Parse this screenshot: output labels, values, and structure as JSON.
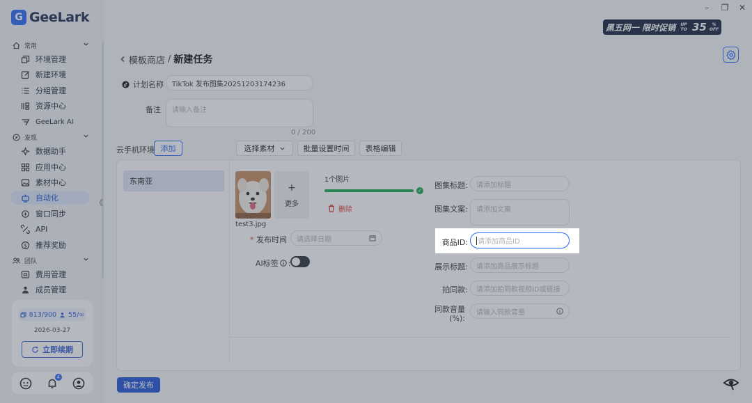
{
  "app": {
    "name": "GeeLark",
    "logo_letter": "G"
  },
  "sidebar": {
    "sections": [
      {
        "label": "常用",
        "items": [
          "环境管理",
          "新建环境",
          "分组管理",
          "资源中心",
          "GeeLark AI"
        ]
      },
      {
        "label": "发现",
        "items": [
          "数据助手",
          "应用中心",
          "素材中心",
          "自动化",
          "窗口同步",
          "API",
          "推荐奖励"
        ]
      },
      {
        "label": "团队",
        "items": [
          "费用管理",
          "成员管理"
        ]
      }
    ],
    "active_item": "自动化",
    "collapse_glyph": "《",
    "quota": {
      "envs": "813/900",
      "members": "55/∞"
    },
    "expiry_date": "2026-03-27",
    "renew_label": "立即续期",
    "notification_count": "4"
  },
  "titlebar": {
    "minimize": "–",
    "restore": "❐",
    "close": "✕"
  },
  "promo": {
    "text": "黑五网一 限时促销",
    "up_to": "UP TO",
    "percent": "35",
    "pct_sign": "%",
    "off": "OFF"
  },
  "page": {
    "breadcrumb_parent": "模板商店",
    "separator": "/",
    "title": "新建任务",
    "plan_name_label": "计划名称",
    "plan_name_value": "TikTok 发布图集20251203174236",
    "note_label": "备注",
    "note_placeholder": "请输入备注",
    "note_counter": "0 / 200",
    "env_label": "云手机环境",
    "add_label": "添加",
    "toolbar": {
      "select_material": "选择素材",
      "batch_time": "批量设置时间",
      "table_edit": "表格编辑"
    },
    "region": "东南亚",
    "image": {
      "filename": "test3.jpg",
      "count_label": "1个图片",
      "more_label": "更多",
      "plus": "+",
      "delete_label": "删除",
      "progress": 1.0
    },
    "publish_time": {
      "label": "发布时间",
      "placeholder": "请选择日期"
    },
    "ai_tag": {
      "label": "AI标签",
      "enabled": false
    },
    "fields": {
      "album_title": {
        "label": "图集标题:",
        "placeholder": "请添加标题"
      },
      "album_copy": {
        "label": "图集文案:",
        "placeholder": "请添加文案"
      },
      "product_id": {
        "label": "商品ID:",
        "placeholder": "请添加商品ID"
      },
      "display_title": {
        "label": "展示标题:",
        "placeholder": "请添加商品展示标题"
      },
      "same_style": {
        "label": "拍同款:",
        "placeholder": "请添加拍同款视频ID或链接"
      },
      "same_volume": {
        "label": "同款音量(%):",
        "placeholder": "请输入同款音量"
      }
    },
    "submit_label": "确定发布"
  },
  "colors": {
    "accent": "#1f50d8",
    "success": "#1aa34a",
    "danger": "#e0352b",
    "overlay": "rgba(70,80,95,0.40)"
  }
}
